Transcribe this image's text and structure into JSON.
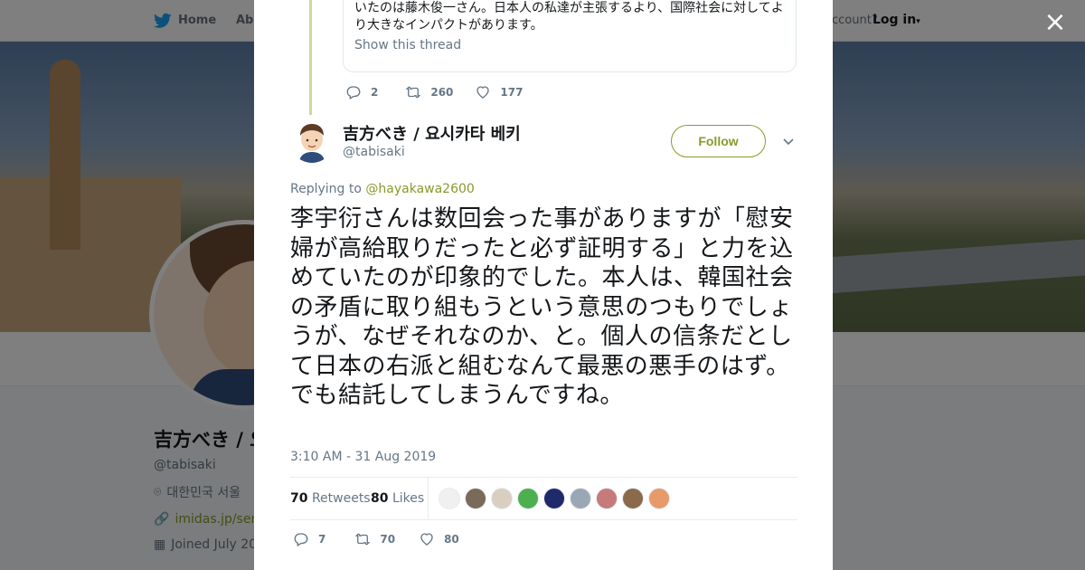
{
  "background_page": {
    "nav": {
      "home": "Home",
      "about_partial": "Abo",
      "account_partial": "ccount?",
      "login": "Log in"
    },
    "profile": {
      "name_partial": "吉方べき / 요",
      "handle": "@tabisaki",
      "location_partial": "대한민국 서울",
      "link_partial": "imidas.jp/sens",
      "joined_partial": "Joined July 20"
    }
  },
  "modal": {
    "close_label": "×",
    "previous_tweet": {
      "text_partial": "いたのは藤木俊一さん。日本人の私達が主張するより、国際社会に対してより大きなインパクトがあります。",
      "show_thread": "Show this thread",
      "replies": "2",
      "retweets": "260",
      "likes": "177"
    },
    "tweet": {
      "author_name": "吉方べき / 요시카타 베키",
      "author_handle": "@tabisaki",
      "follow_label": "Follow",
      "replying_prefix": "Replying to",
      "replying_to": "@hayakawa2600",
      "text": "李宇衍さんは数回会った事がありますが「慰安婦が高給取りだったと必ず証明する」と力を込めていたのが印象的でした。本人は、韓国社会の矛盾に取り組もうという意思のつもりでしょうが、なぜそれなのか、と。個人の信条だとして日本の右派と組むなんて最悪の悪手のはず。でも結託してしまうんですね。",
      "timestamp": "3:10 AM - 31 Aug 2019",
      "retweet_count": "70",
      "retweets_label": "Retweets",
      "like_count": "80",
      "likes_label": "Likes",
      "replies": "7",
      "retweets": "70",
      "likes": "80"
    },
    "likers": [
      "#f0f0f0",
      "#7a6a5a",
      "#d8cfc0",
      "#4caf50",
      "#1e2a6a",
      "#9aa8b5",
      "#c77a7a",
      "#8a6a4a",
      "#e89a6a"
    ]
  },
  "colors": {
    "accent": "#8a9a2b",
    "text": "#14171a",
    "muted": "#657786"
  }
}
